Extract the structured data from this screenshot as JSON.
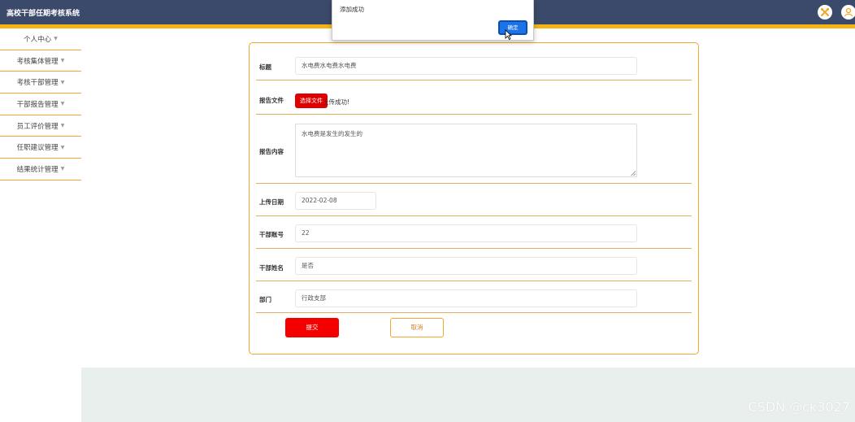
{
  "header": {
    "title": "高校干部任期考核系统",
    "icons": [
      "tools-icon",
      "user-icon"
    ]
  },
  "sidebar": {
    "items": [
      {
        "label": "个人中心"
      },
      {
        "label": "考核集体管理"
      },
      {
        "label": "考核干部管理"
      },
      {
        "label": "干部报告管理"
      },
      {
        "label": "员工评价管理"
      },
      {
        "label": "任职建议管理"
      },
      {
        "label": "结果统计管理"
      }
    ]
  },
  "form": {
    "title_label": "标题",
    "title_value": "水电费水电费水电费",
    "file_label": "报告文件",
    "choose_file": "选择文件",
    "upload_status": "上传成功!",
    "content_label": "报告内容",
    "content_value": "水电费是发生的发生的",
    "date_label": "上传日期",
    "date_value": "2022-02-08",
    "account_label": "干部账号",
    "account_value": "22",
    "name_label": "干部姓名",
    "name_value": "是否",
    "dept_label": "部门",
    "dept_value": "行政支部",
    "submit": "提交",
    "cancel": "取消"
  },
  "dialog": {
    "message": "添加成功",
    "ok": "确定"
  },
  "watermark": "CSDN @ck3027",
  "colors": {
    "header_bg": "#3b4a6b",
    "accent_stripe": "#f5b414",
    "primary_red": "#f40000",
    "border_orange": "#f0a830",
    "dialog_button": "#1a73e8"
  }
}
